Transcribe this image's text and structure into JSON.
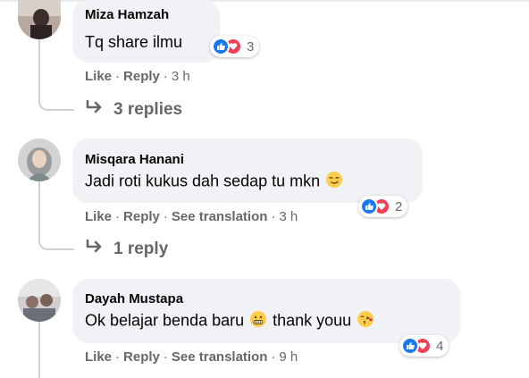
{
  "comments": [
    {
      "author": "Miza Hamzah",
      "text": "Tq share ilmu",
      "reactions": {
        "count": "3",
        "types": [
          "like-icon",
          "love-icon"
        ]
      },
      "actions": {
        "like": "Like",
        "reply": "Reply",
        "time": "3 h"
      },
      "replies_label": "3 replies"
    },
    {
      "author": "Misqara Hanani",
      "text": "Jadi roti kukus dah sedap tu mkn",
      "emoji": "smirk-emoji",
      "reactions": {
        "count": "2",
        "types": [
          "like-icon",
          "love-icon"
        ]
      },
      "actions": {
        "like": "Like",
        "reply": "Reply",
        "translate": "See translation",
        "time": "3 h"
      },
      "replies_label": "1 reply"
    },
    {
      "author": "Dayah Mustapa",
      "text_before": "Ok belajar benda baru",
      "text_after": "thank youu",
      "emojis": [
        "grimacing-emoji",
        "kiss-heart-emoji"
      ],
      "reactions": {
        "count": "4",
        "types": [
          "like-icon",
          "love-icon"
        ]
      },
      "actions": {
        "like": "Like",
        "reply": "Reply",
        "translate": "See translation",
        "time": "9 h"
      }
    }
  ],
  "colors": {
    "bubble": "#f0f2f5",
    "secondary_text": "#65676b",
    "like_blue": "#1877f2",
    "love_red": "#f33e58"
  }
}
